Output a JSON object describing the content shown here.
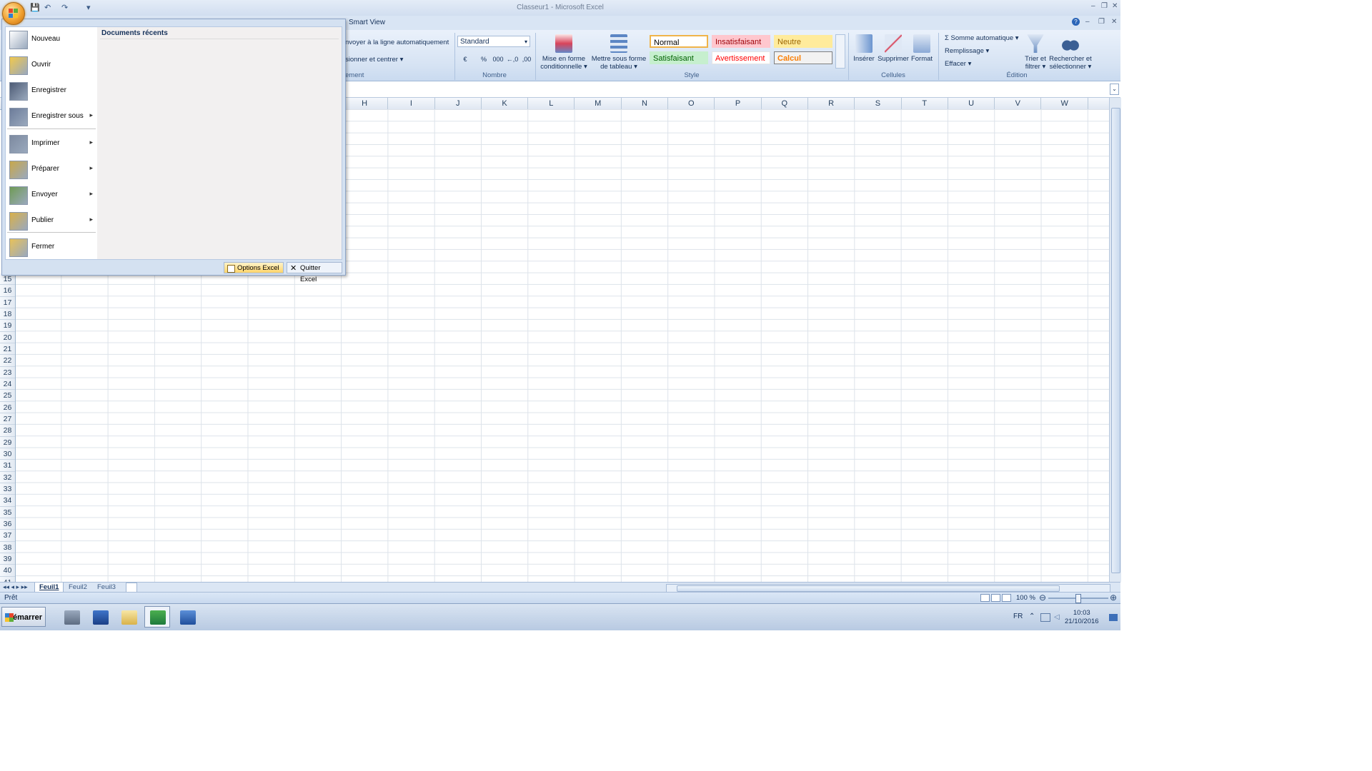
{
  "window": {
    "title": "Classeur1 - Microsoft Excel",
    "help_glyph": "?",
    "min_glyph": "–",
    "max_glyph": "❐",
    "close_glyph": "✕"
  },
  "quick_access": {
    "save_icon": "💾",
    "undo_icon": "↶",
    "redo_icon": "↷",
    "customize_icon": "▾"
  },
  "ribbon": {
    "tab_smart_view": "Smart View",
    "alignment": {
      "wrap_text": "nvoyer à la ligne automatiquement",
      "merge_center": "sionner et centrer ▾",
      "group_label": "ement"
    },
    "number": {
      "format_value": "Standard",
      "group_label": "Nombre",
      "currency": "€",
      "percent": "%",
      "thousands": "000",
      "inc_decimal": "←,0",
      "dec_decimal": ",00"
    },
    "styles": {
      "conditional_format": "Mise en forme",
      "conditional_format_2": "conditionnelle ▾",
      "format_as_table": "Mettre sous forme",
      "format_as_table_2": "de tableau ▾",
      "normal": "Normal",
      "bad": "Insatisfaisant",
      "neutral": "Neutre",
      "good": "Satisfaisant",
      "warning": "Avertissement",
      "calculation": "Calcul",
      "group_label": "Style"
    },
    "cells": {
      "insert": "Insérer",
      "delete": "Supprimer",
      "format": "Format",
      "group_label": "Cellules"
    },
    "editing": {
      "autosum": "Σ  Somme automatique ▾",
      "fill": "Remplissage ▾",
      "clear": "Effacer ▾",
      "sort_filter": "Trier et",
      "sort_filter_2": "filtrer ▾",
      "find_select": "Rechercher et",
      "find_select_2": "sélectionner ▾",
      "group_label": "Édition"
    }
  },
  "grid": {
    "columns": [
      "H",
      "I",
      "J",
      "K",
      "L",
      "M",
      "N",
      "O",
      "P",
      "Q",
      "R",
      "S",
      "T",
      "U",
      "V",
      "W"
    ],
    "rows": [
      "15",
      "16",
      "17",
      "18",
      "19",
      "20",
      "21",
      "22",
      "23",
      "24",
      "25",
      "26",
      "27",
      "28",
      "29",
      "30",
      "31",
      "32",
      "33",
      "34",
      "35",
      "36",
      "37",
      "38",
      "39",
      "40",
      "41"
    ]
  },
  "office_menu": {
    "items": [
      {
        "label": "Nouveau",
        "has_submenu": false
      },
      {
        "label": "Ouvrir",
        "has_submenu": false
      },
      {
        "label": "Enregistrer",
        "has_submenu": false
      },
      {
        "label": "Enregistrer sous",
        "has_submenu": true
      },
      {
        "label": "Imprimer",
        "has_submenu": true
      },
      {
        "label": "Préparer",
        "has_submenu": true
      },
      {
        "label": "Envoyer",
        "has_submenu": true
      },
      {
        "label": "Publier",
        "has_submenu": true
      },
      {
        "label": "Fermer",
        "has_submenu": false
      }
    ],
    "recent_docs_header": "Documents récents",
    "options_button": "Options Excel",
    "quit_button": "Quitter Excel",
    "submenu_arrow": "▸"
  },
  "sheets": {
    "tabs": [
      "Feuil1",
      "Feuil2",
      "Feuil3"
    ],
    "active": "Feuil1",
    "nav": "◂◂ ◂ ▸ ▸▸"
  },
  "status": {
    "ready": "Prêt",
    "zoom": "100 %",
    "zoom_minus": "⊖",
    "zoom_plus": "⊕"
  },
  "taskbar": {
    "start": "Démarrer",
    "lang": "FR",
    "time": "10:03",
    "date": "21/10/2016"
  },
  "colors": {
    "ribbon_bg": "#d6e3f3",
    "accent": "#f0a030",
    "excel_green": "#1e7a3c"
  }
}
